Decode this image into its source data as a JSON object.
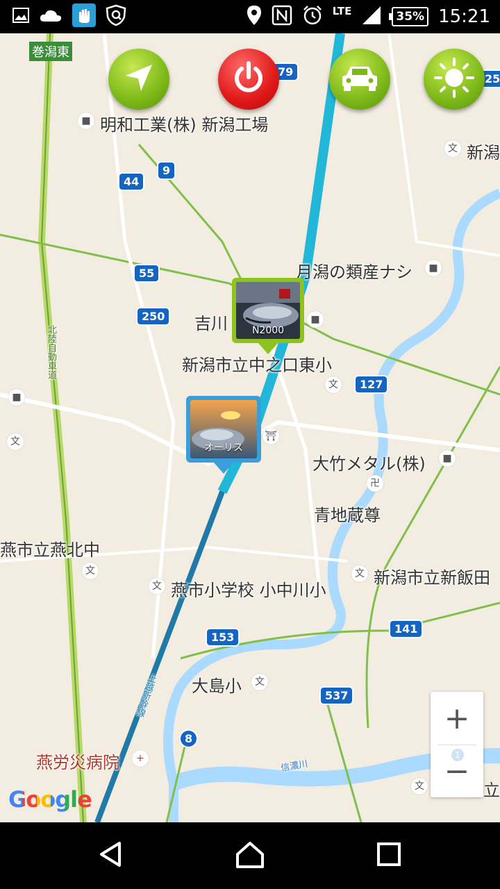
{
  "status_bar": {
    "network": "LTE",
    "battery": "35%",
    "time": "15:21",
    "icons": [
      "image-icon",
      "cloud-icon",
      "hand-app-icon",
      "shield-app-icon",
      "location-icon",
      "nfc-icon",
      "alarm-icon",
      "signal-icon",
      "battery-icon"
    ]
  },
  "toolbar": {
    "buttons": [
      {
        "name": "navigate-button",
        "icon": "navigation-arrow-icon"
      },
      {
        "name": "power-button",
        "icon": "power-icon"
      },
      {
        "name": "car-button",
        "icon": "car-icon"
      },
      {
        "name": "brightness-button",
        "icon": "sun-icon"
      }
    ],
    "colors": {
      "green": "#7cb818",
      "red": "#e01818"
    }
  },
  "map": {
    "labels": {
      "l1": "巻潟東",
      "l2": "明和工業(株) 新潟工場",
      "l3": "新潟",
      "l4": "月潟の類産ナシ",
      "l5": "吉川",
      "l6": "新潟市立中之口東小",
      "l7": "大竹メタル(株)",
      "l8": "青地蔵尊",
      "l9": "燕市立燕北中",
      "l10": "燕市小学校 小中川小",
      "l11": "新潟市立新飯田",
      "l12": "大島小",
      "l13": "燕労災病院",
      "l14": "三条市立",
      "l15": "北陸自動車道",
      "l16": "上越新幹線",
      "l17": "信濃川"
    },
    "shields": {
      "s1": "79",
      "s2": "25",
      "s3": "9",
      "s4": "44",
      "s5": "55",
      "s6": "250",
      "s7": "127",
      "s8": "153",
      "s9": "141",
      "s10": "537",
      "s11": "8"
    },
    "poi": {
      "school": "文",
      "shrine": "⛩",
      "temple": "卍",
      "hospital": "+"
    }
  },
  "markers": [
    {
      "label": "N2000",
      "color": "#8dc21f"
    },
    {
      "label": "オーリス",
      "color": "#3a9fd8"
    }
  ],
  "zoom": {
    "in": "+",
    "out": "−",
    "badge": "1"
  },
  "attribution": "Google",
  "nav": [
    "back-icon",
    "home-icon",
    "recents-icon"
  ]
}
